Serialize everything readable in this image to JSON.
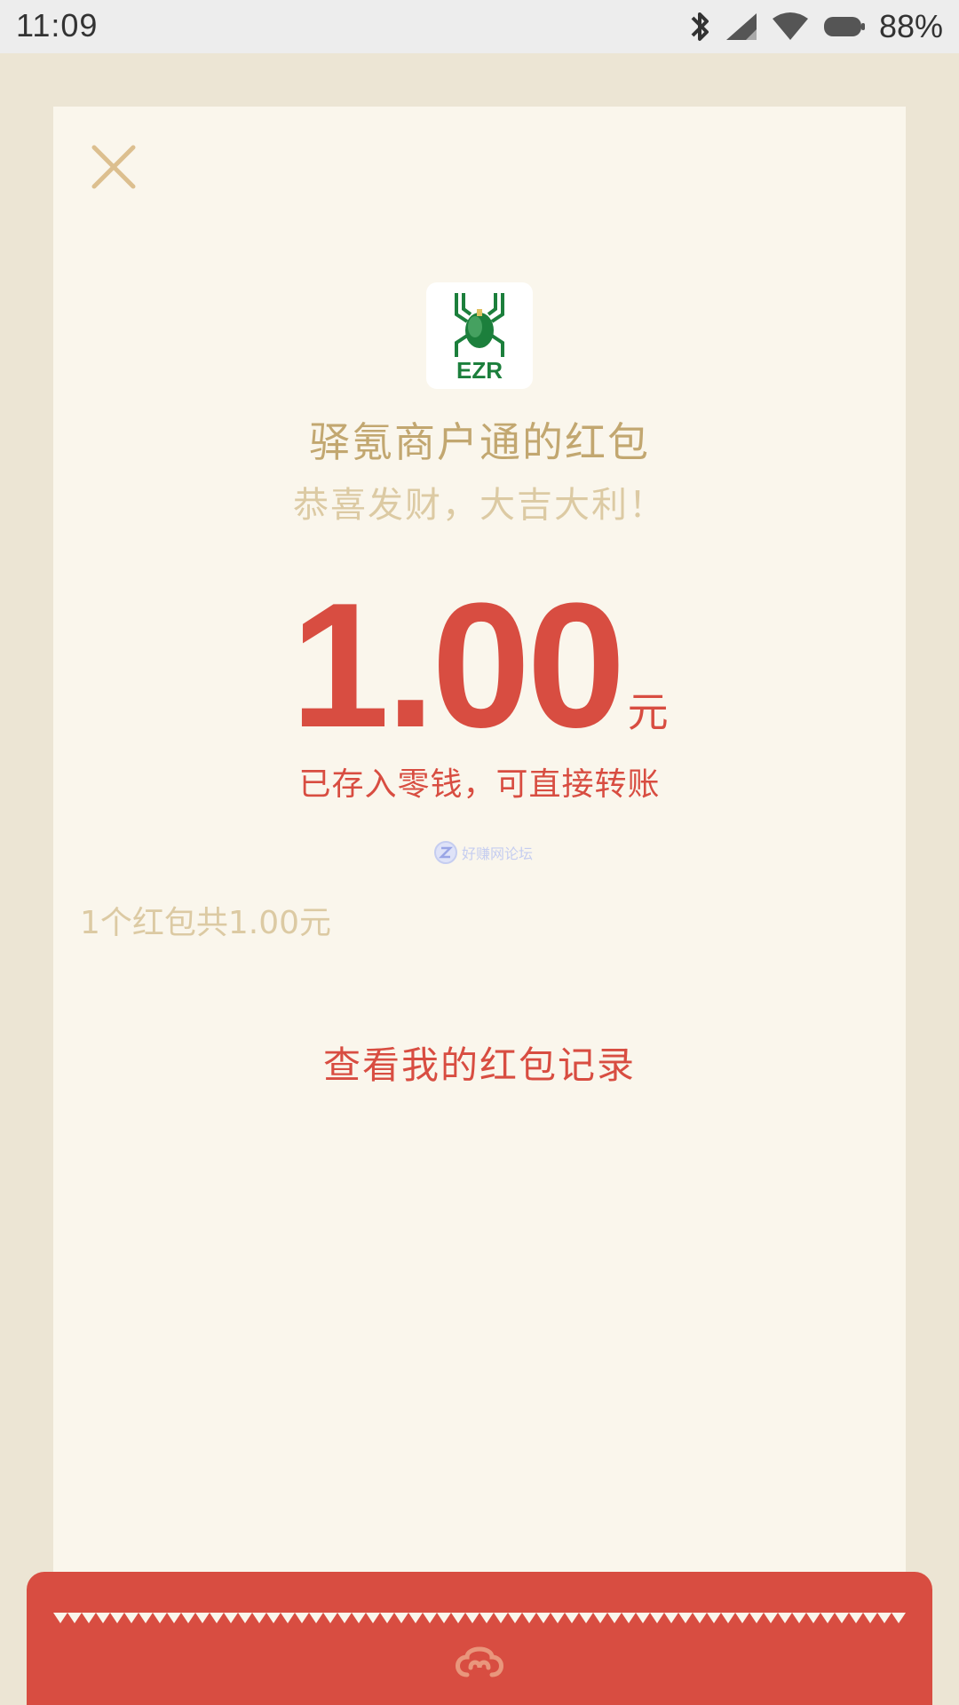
{
  "status_bar": {
    "time": "11:09",
    "battery_percent": "88%",
    "icons": [
      "bluetooth-icon",
      "signal-icon",
      "wifi-icon",
      "battery-icon"
    ]
  },
  "red_packet": {
    "close_icon": "close-icon",
    "sender_logo_text": "EZR",
    "sender_name": "驿氪商户通的红包",
    "greeting": "恭喜发财，大吉大利！",
    "amount": "1.00",
    "unit": "元",
    "saved_note": "已存入零钱，可直接转账",
    "watermark": "好赚网论坛",
    "total_info": "1个红包共1.00元",
    "record_link": "查看我的红包记录"
  },
  "colors": {
    "accent_red": "#d84d41",
    "gold_text": "#c2a770",
    "card_bg": "#faf6ec",
    "page_bg": "#ece5d4",
    "logo_green": "#1c7f3c"
  }
}
